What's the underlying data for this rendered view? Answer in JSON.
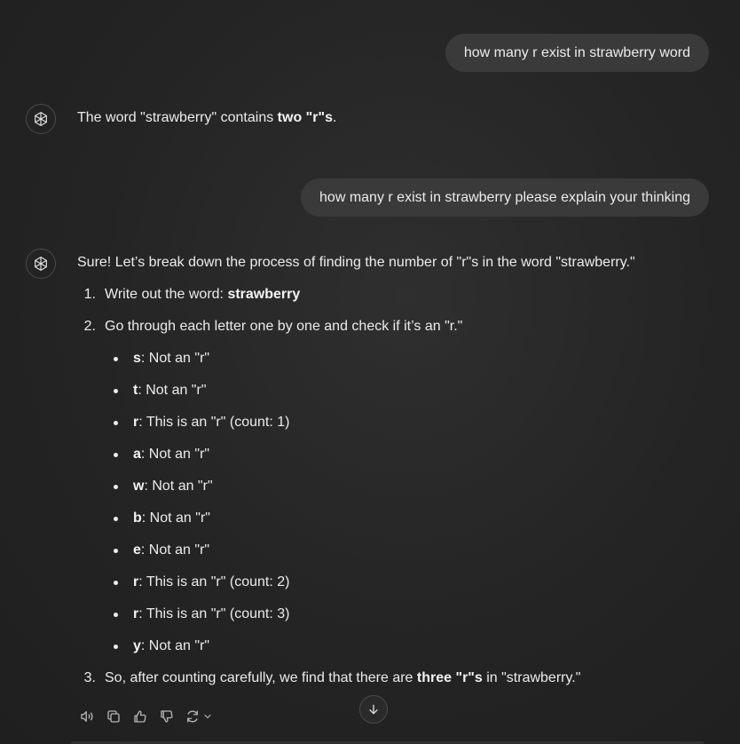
{
  "conversation": {
    "user_messages": [
      "how many r exist in strawberry word",
      "how many r exist in strawberry please explain your thinking"
    ],
    "answer1": {
      "prefix": "The word \"strawberry\" contains ",
      "bold": "two \"r\"s",
      "suffix": "."
    },
    "answer2": {
      "intro": "Sure! Let’s break down the process of finding the number of \"r\"s in the word \"strawberry.\"",
      "steps": [
        {
          "num": "1.",
          "text": "Write out the word: ",
          "bold": "strawberry",
          "suffix": ""
        },
        {
          "num": "2.",
          "text": "Go through each letter one by one and check if it’s an \"r.\"",
          "bold": "",
          "suffix": ""
        },
        {
          "num": "3.",
          "text": "So, after counting carefully, we find that there are ",
          "bold": "three \"r\"s",
          "suffix": " in \"strawberry.\""
        }
      ],
      "letters": [
        {
          "letter": "s",
          "desc": ": Not an \"r\""
        },
        {
          "letter": "t",
          "desc": ": Not an \"r\""
        },
        {
          "letter": "r",
          "desc": ": This is an \"r\" (count: 1)"
        },
        {
          "letter": "a",
          "desc": ": Not an \"r\""
        },
        {
          "letter": "w",
          "desc": ": Not an \"r\""
        },
        {
          "letter": "b",
          "desc": ": Not an \"r\""
        },
        {
          "letter": "e",
          "desc": ": Not an \"r\""
        },
        {
          "letter": "r",
          "desc": ": This is an \"r\" (count: 2)"
        },
        {
          "letter": "r",
          "desc": ": This is an \"r\" (count: 3)"
        },
        {
          "letter": "y",
          "desc": ": Not an \"r\""
        }
      ]
    }
  },
  "actions": {
    "icons": [
      "read-aloud-icon",
      "copy-icon",
      "thumbs-up-icon",
      "thumbs-down-icon",
      "regenerate-icon",
      "chevron-down-icon"
    ]
  },
  "scroll": {
    "icon": "arrow-down-icon"
  },
  "colors": {
    "background": "#262626",
    "bubble": "#3a3a3a",
    "text": "#ececec"
  }
}
